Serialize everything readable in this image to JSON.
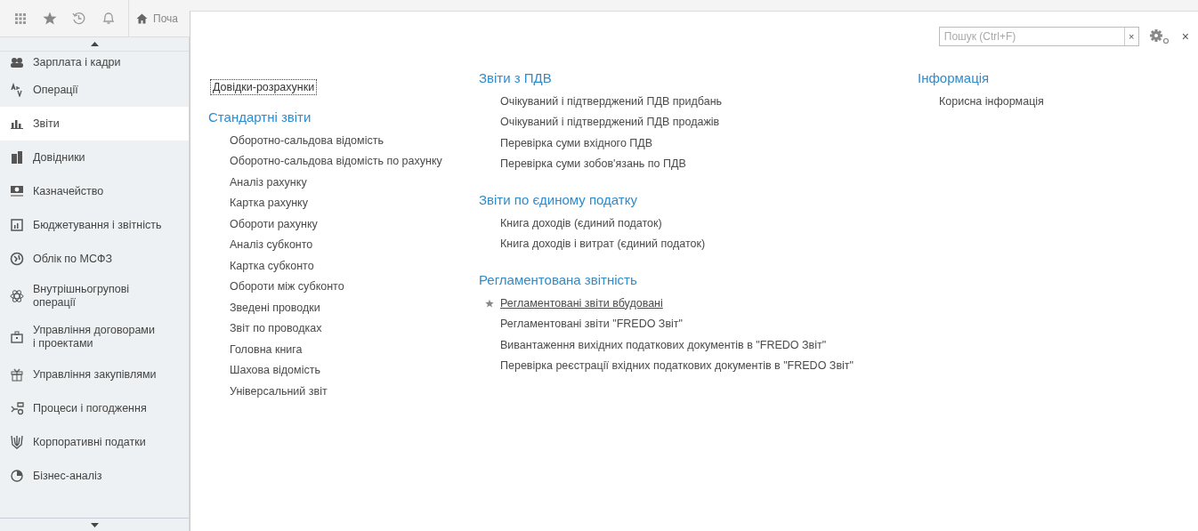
{
  "top_bar": {
    "home_tab": "Поча"
  },
  "sidebar": {
    "items": [
      {
        "label": "Зарплата і кадри",
        "selected": false
      },
      {
        "label": "Операції",
        "selected": false
      },
      {
        "label": "Звіти",
        "selected": true
      },
      {
        "label": "Довідники",
        "selected": false
      },
      {
        "label": "Казначейство",
        "selected": false
      },
      {
        "label": "Бюджетування і звітність",
        "selected": false
      },
      {
        "label": "Облік по МСФЗ",
        "selected": false
      },
      {
        "label": "Внутрішньогрупові операції",
        "selected": false
      },
      {
        "label": "Управління договорами і проектами",
        "selected": false
      },
      {
        "label": "Управління закупівлями",
        "selected": false
      },
      {
        "label": "Процеси і погодження",
        "selected": false
      },
      {
        "label": "Корпоративні податки",
        "selected": false
      },
      {
        "label": "Бізнес-аналіз",
        "selected": false
      }
    ]
  },
  "panel": {
    "search": {
      "placeholder": "Пошук (Ctrl+F)",
      "clear_button": "×"
    },
    "close_button": "×",
    "columns": [
      {
        "top_link": {
          "label": "Довідки-розрахунки",
          "focused": true
        },
        "groups": [
          {
            "title": "Стандартні звіти",
            "items": [
              {
                "label": "Оборотно-сальдова відомість",
                "favorite": false,
                "hovered": false
              },
              {
                "label": "Оборотно-сальдова відомість по рахунку",
                "favorite": false,
                "hovered": false
              },
              {
                "label": "Аналіз рахунку",
                "favorite": false,
                "hovered": false
              },
              {
                "label": "Картка рахунку",
                "favorite": false,
                "hovered": false
              },
              {
                "label": "Обороти рахунку",
                "favorite": false,
                "hovered": false
              },
              {
                "label": "Аналіз субконто",
                "favorite": false,
                "hovered": false
              },
              {
                "label": "Картка субконто",
                "favorite": false,
                "hovered": false
              },
              {
                "label": "Обороти між субконто",
                "favorite": false,
                "hovered": false
              },
              {
                "label": "Зведені проводки",
                "favorite": false,
                "hovered": false
              },
              {
                "label": "Звіт по проводках",
                "favorite": false,
                "hovered": false
              },
              {
                "label": "Головна книга",
                "favorite": false,
                "hovered": false
              },
              {
                "label": "Шахова відомість",
                "favorite": false,
                "hovered": false
              },
              {
                "label": "Універсальний звіт",
                "favorite": false,
                "hovered": false
              }
            ]
          }
        ]
      },
      {
        "groups": [
          {
            "title": "Звіти з ПДВ",
            "items": [
              {
                "label": "Очікуваний і підтверджений ПДВ придбань",
                "favorite": false,
                "hovered": false
              },
              {
                "label": "Очікуваний і підтверджений ПДВ продажів",
                "favorite": false,
                "hovered": false
              },
              {
                "label": "Перевірка суми вхідного ПДВ",
                "favorite": false,
                "hovered": false
              },
              {
                "label": "Перевірка суми зобов'язань по ПДВ",
                "favorite": false,
                "hovered": false
              }
            ]
          },
          {
            "title": "Звіти по єдиному податку",
            "items": [
              {
                "label": "Книга доходів (єдиний податок)",
                "favorite": false,
                "hovered": false
              },
              {
                "label": "Книга доходів і витрат (єдиний податок)",
                "favorite": false,
                "hovered": false
              }
            ]
          },
          {
            "title": "Регламентована звітність",
            "items": [
              {
                "label": "Регламентовані звіти вбудовані",
                "favorite": true,
                "hovered": true
              },
              {
                "label": "Регламентовані звіти \"FREDO Звіт\"",
                "favorite": false,
                "hovered": false
              },
              {
                "label": "Вивантаження вихідних податкових документів в \"FREDO Звіт\"",
                "favorite": false,
                "hovered": false
              },
              {
                "label": "Перевірка реєстрації вхідних податкових документів в \"FREDO Звіт\"",
                "favorite": false,
                "hovered": false
              }
            ]
          }
        ]
      },
      {
        "groups": [
          {
            "title": "Інформація",
            "items": [
              {
                "label": "Корисна інформація",
                "favorite": false,
                "hovered": false
              }
            ]
          }
        ]
      }
    ]
  }
}
